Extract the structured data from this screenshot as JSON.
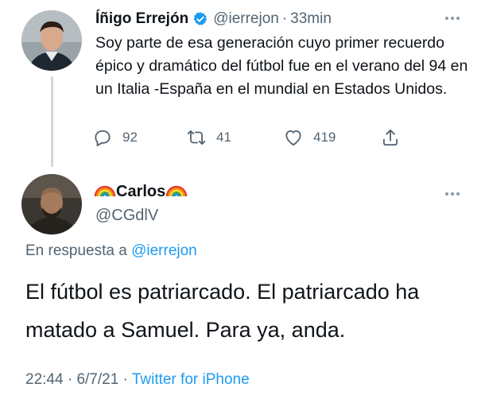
{
  "tweet1": {
    "author_name": "Íñigo Errejón",
    "handle": "@ierrejon",
    "separator": "·",
    "time_ago": "33min",
    "text": "Soy parte de esa generación cuyo primer recuerdo épico y dramático del fútbol fue en el verano del 94 en un Italia -España en el mundial en Estados Unidos.",
    "replies": "92",
    "retweets": "41",
    "likes": "419"
  },
  "tweet2": {
    "author_name": "Carlos",
    "handle": "@CGdlV",
    "reply_prefix": "En respuesta a ",
    "reply_to": "@ierrejon",
    "text": "El fútbol es patriarcado. El patriarcado ha matado a Samuel. Para ya, anda.",
    "time": "22:44",
    "separator": " · ",
    "date": "6/7/21",
    "source": "Twitter for iPhone"
  },
  "colors": {
    "accent": "#1d9bf0",
    "secondary_text": "#536471",
    "thread_line": "#cfd9de"
  }
}
